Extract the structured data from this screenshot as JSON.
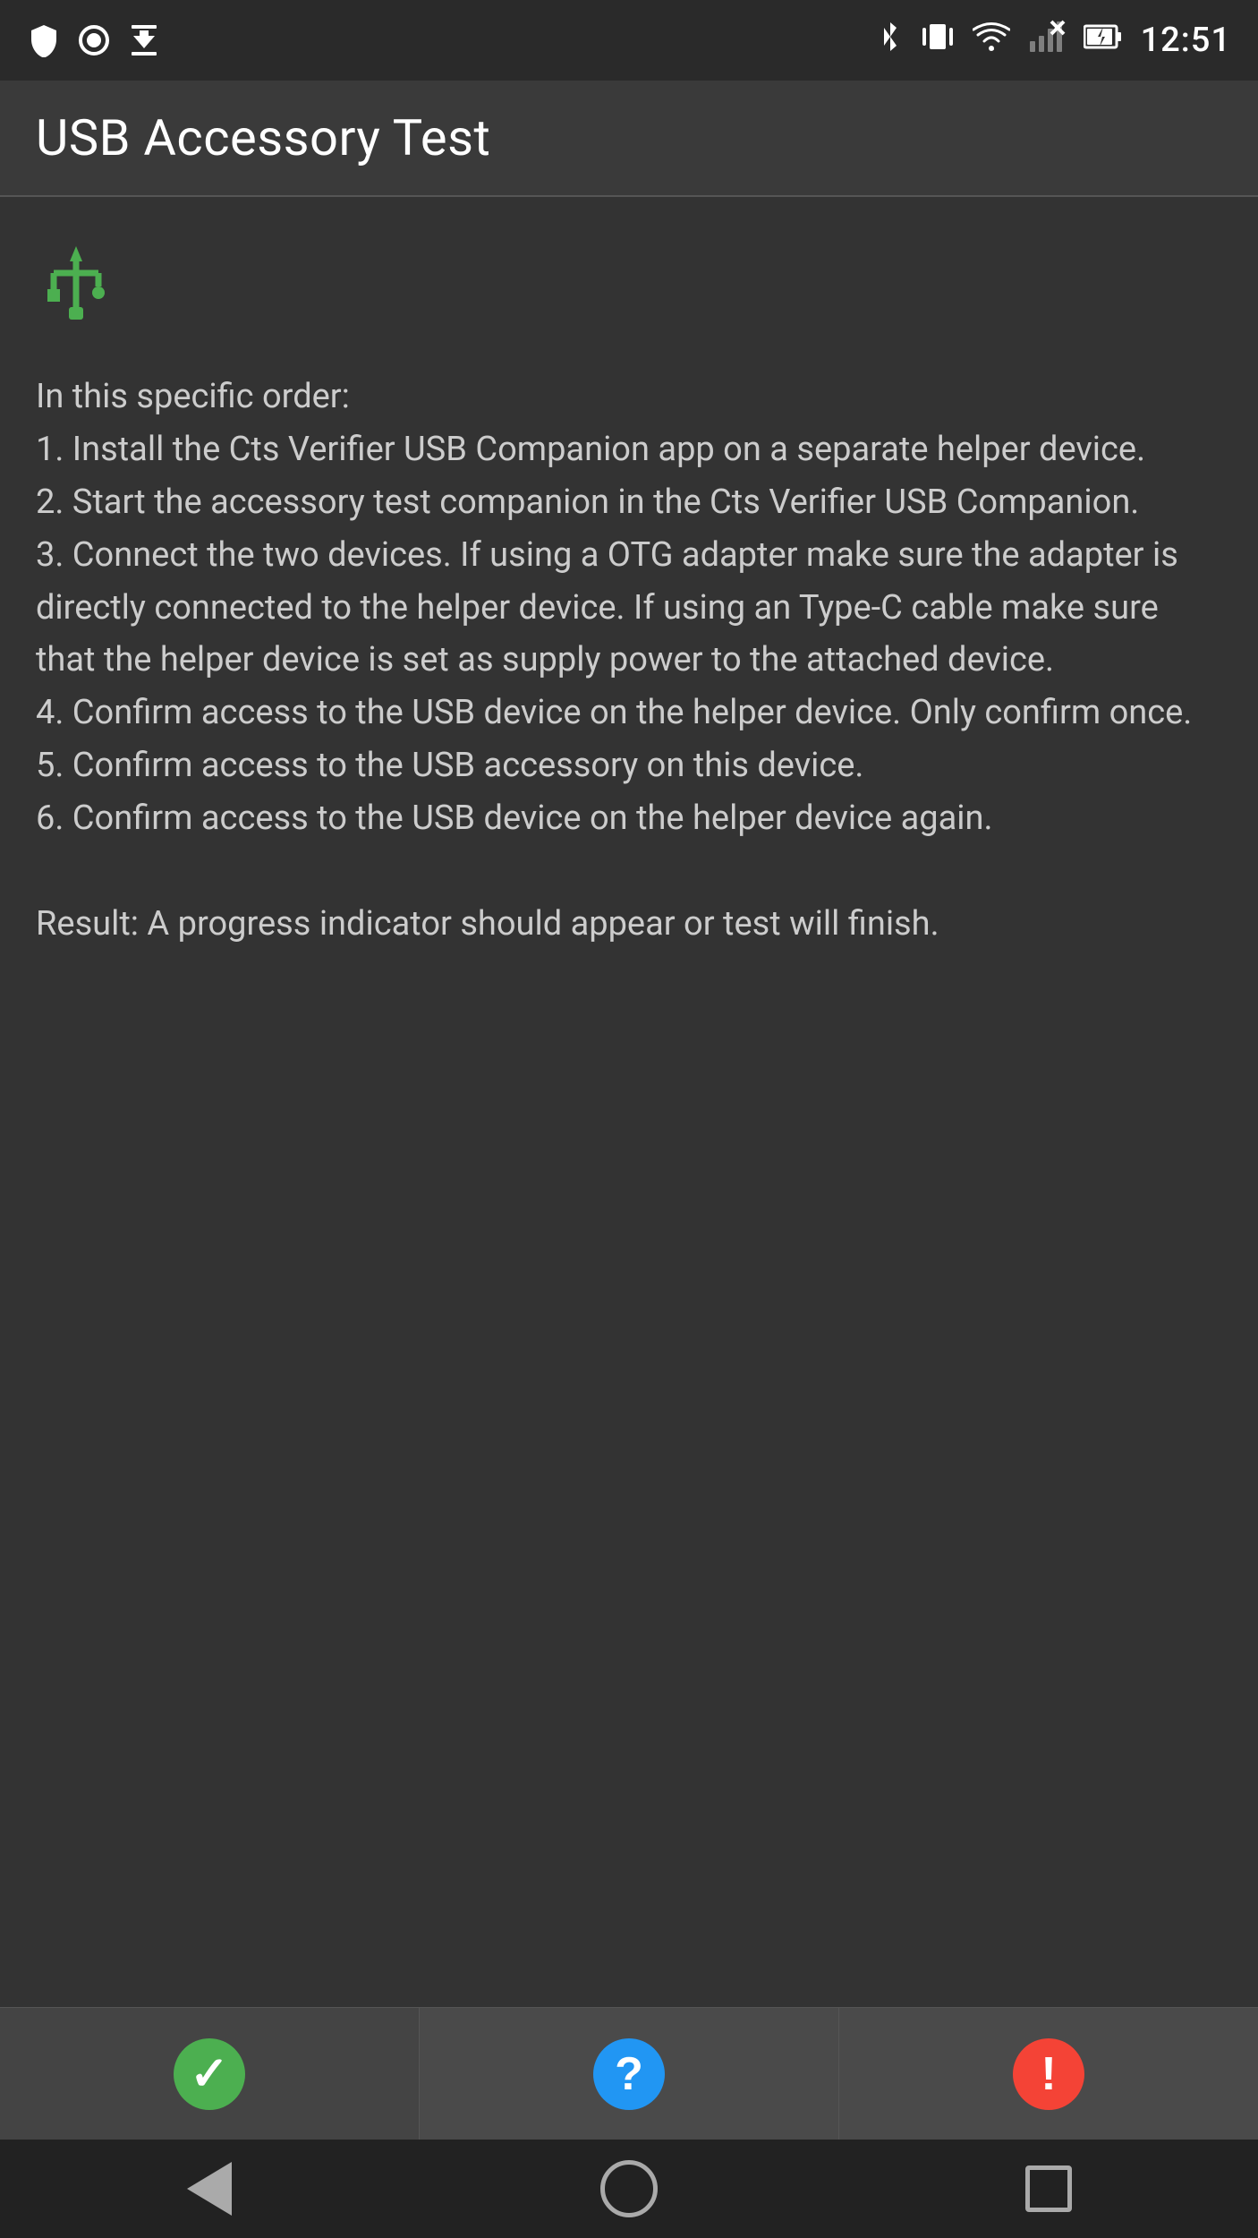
{
  "statusBar": {
    "time": "12:51",
    "icons": {
      "shield": "shield",
      "circle": "circle",
      "download": "download",
      "bluetooth": "bluetooth",
      "vibrate": "vibrate",
      "wifi": "wifi",
      "signal": "signal",
      "battery": "battery"
    }
  },
  "appBar": {
    "title": "USB Accessory Test"
  },
  "content": {
    "usbIcon": "⌬",
    "instructions": "In this specific order:\n1. Install the Cts Verifier USB Companion app on a separate helper device.\n2. Start the accessory test companion in the Cts Verifier USB Companion.\n3. Connect the two devices. If using a OTG adapter make sure the adapter is directly connected to the helper device. If using an Type-C cable make sure that the helper device is set as supply power to the attached device.\n4. Confirm access to the USB device on the helper device. Only confirm once.\n5. Confirm access to the USB accessory on this device.\n6. Confirm access to the USB device on the helper device again.\n\nResult: A progress indicator should appear or test will finish."
  },
  "bottomButtons": {
    "pass": {
      "label": "✓",
      "ariaLabel": "Pass"
    },
    "info": {
      "label": "?",
      "ariaLabel": "Info"
    },
    "fail": {
      "label": "!",
      "ariaLabel": "Fail"
    }
  },
  "navBar": {
    "back": "Back",
    "home": "Home",
    "recents": "Recents"
  }
}
